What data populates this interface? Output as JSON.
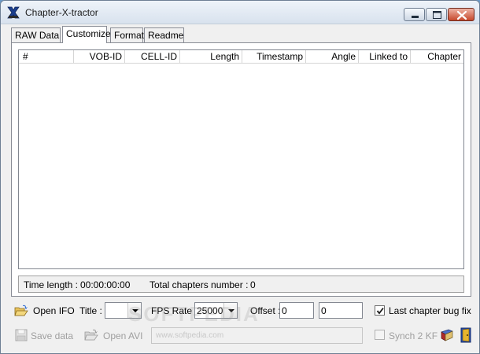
{
  "window": {
    "title": "Chapter-X-tractor",
    "icon": "chapter-x-tractor-logo-icon"
  },
  "tabs": [
    {
      "label": "RAW Data",
      "active": false
    },
    {
      "label": "Customize",
      "active": true
    },
    {
      "label": "Format",
      "active": false
    },
    {
      "label": "Readme",
      "active": false
    }
  ],
  "table": {
    "columns": [
      "#",
      "VOB-ID",
      "CELL-ID",
      "Length",
      "Timestamp",
      "Angle",
      "Linked to",
      "Chapter"
    ],
    "rows": []
  },
  "status": {
    "time_length_label": "Time length :",
    "time_length_value": "00:00:00:00",
    "total_chapters_label": "Total chapters number :",
    "total_chapters_value": "0"
  },
  "controls": {
    "open_ifo_label": "Open IFO",
    "title_label": "Title :",
    "title_value": "",
    "fps_label": "FPS Rate :",
    "fps_value": "25000",
    "offset_label": "Offset :",
    "offset_value_1": "0",
    "offset_value_2": "0",
    "last_chapter_label": "Last chapter bug fix",
    "last_chapter_checked": true,
    "save_data_label": "Save data",
    "open_avi_label": "Open AVI",
    "avi_path": "",
    "synch_label": "Synch 2 KF",
    "synch_checked": false
  },
  "watermark": {
    "text": "SOFTPEDIA",
    "url": "www.softpedia.com"
  },
  "colors": {
    "close_button": "#c6482c",
    "title_bar": "#dfe8f2",
    "window_bg": "#f0f0f0"
  }
}
